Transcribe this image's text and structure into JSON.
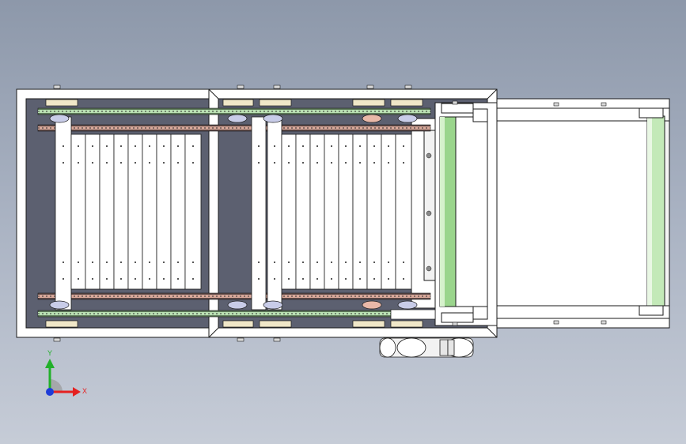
{
  "viewport": {
    "background_top": "#8d98aa",
    "background_bottom": "#c6ccd7",
    "frame_color": "#ffffff",
    "edge_color": "#1a1a1a",
    "chain_color": "#9fd09a",
    "chain_accent": "#d69a8a",
    "roller_color": "#9ad58c",
    "bearing_color": "#f0e7c8"
  },
  "triad": {
    "x_label": "X",
    "y_label": "Y",
    "x_color": "#e52020",
    "y_color": "#22b02a",
    "z_color": "#1e3cd8"
  }
}
